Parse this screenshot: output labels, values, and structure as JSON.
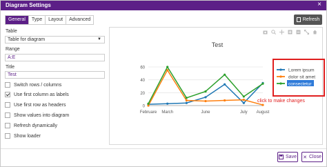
{
  "window": {
    "title": "Diagram Settings",
    "close_glyph": "×"
  },
  "tabs": [
    {
      "label": "General",
      "active": true
    },
    {
      "label": "Type",
      "active": false
    },
    {
      "label": "Layout",
      "active": false
    },
    {
      "label": "Advanced",
      "active": false
    }
  ],
  "toolbar": {
    "refresh_label": "Refresh",
    "refresh_icon": "document-icon"
  },
  "form": {
    "table": {
      "label": "Table",
      "value": "Table for diagram"
    },
    "range": {
      "label": "Range",
      "value": "A:E"
    },
    "title": {
      "label": "Title",
      "value": "Test"
    },
    "checkboxes": [
      {
        "label": "Switch rows / columns",
        "checked": false
      },
      {
        "label": "Use first column as labels",
        "checked": true
      },
      {
        "label": "Use first row as headers",
        "checked": false
      },
      {
        "label": "Show values into diagram",
        "checked": false
      },
      {
        "label": "Refresh dynamically",
        "checked": false
      },
      {
        "label": "Show loader",
        "checked": false
      }
    ]
  },
  "chart_toolbar_icons": [
    "camera-icon",
    "zoom-icon",
    "pan-icon",
    "zoom-in-icon",
    "zoom-out-icon",
    "autoscale-icon",
    "home-icon"
  ],
  "chart_data": {
    "type": "line",
    "title": "Test",
    "categories": [
      "Februare",
      "March",
      "",
      "June",
      "",
      "July",
      "August"
    ],
    "x_tick_labels": [
      "Februare",
      "March",
      "June",
      "July",
      "August"
    ],
    "y_ticks": [
      "0",
      "20",
      "40",
      "60"
    ],
    "ylim": [
      0,
      60
    ],
    "grid": true,
    "legend_position": "right",
    "series": [
      {
        "name": "Lorem ipsum",
        "color": "#1f77b4",
        "values": [
          2,
          3,
          4,
          13,
          33,
          4,
          35
        ]
      },
      {
        "name": "dolor sit amet",
        "color": "#ff7f0e",
        "values": [
          0,
          55,
          8,
          7,
          8,
          9,
          1
        ]
      },
      {
        "name": "consectetur",
        "color": "#2ca02c",
        "values": [
          3,
          60,
          12,
          22,
          48,
          14,
          34
        ]
      }
    ],
    "selected_legend_index": 2
  },
  "annotation": {
    "text": "click to make changes",
    "color": "#e01e1e"
  },
  "footer": {
    "save_label": "Save",
    "close_label": "Close"
  },
  "colors": {
    "accent": "#5c1f87",
    "annotation": "#e01e1e"
  }
}
